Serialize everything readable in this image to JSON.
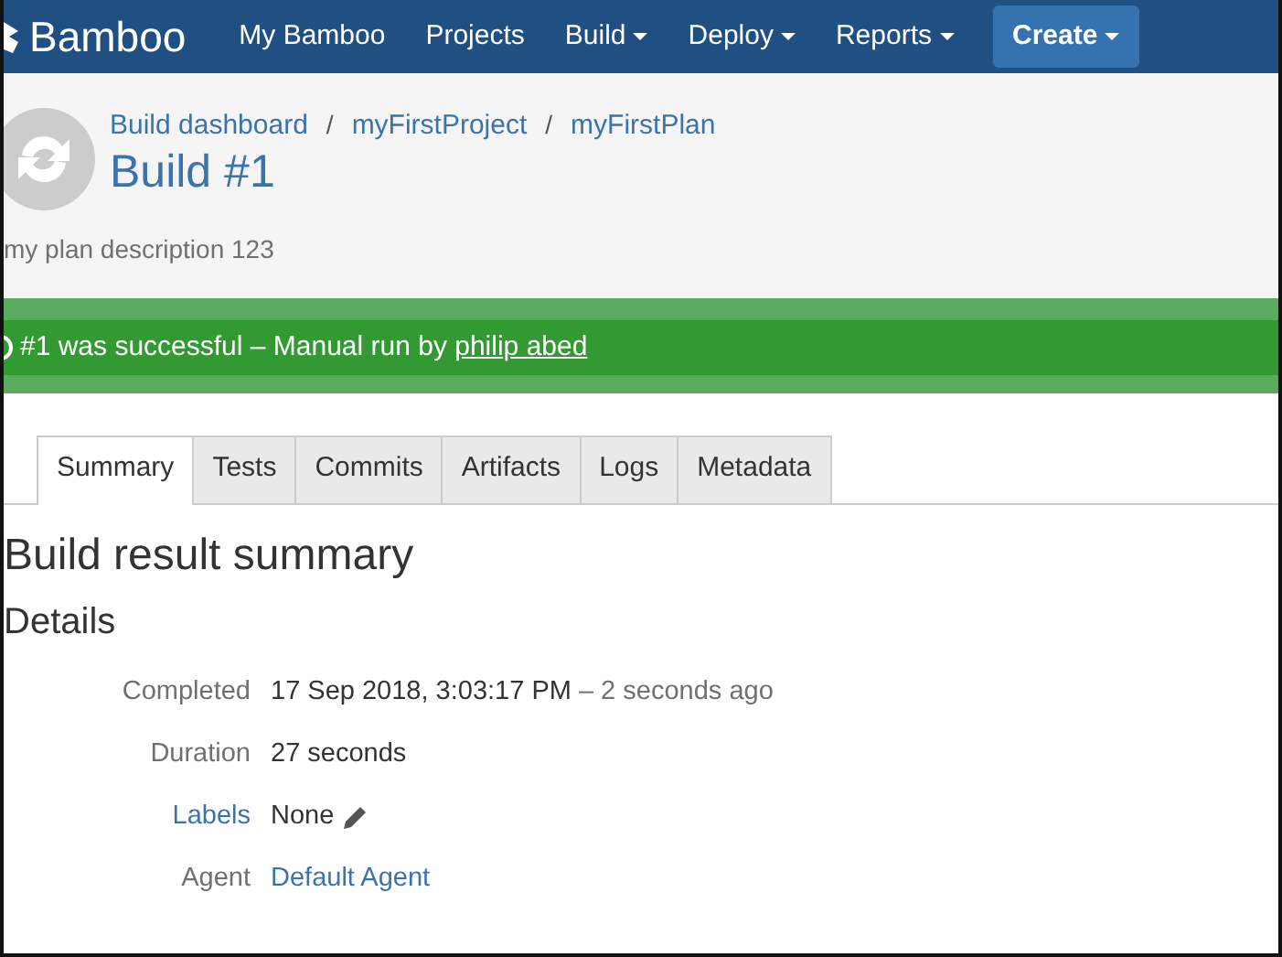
{
  "navbar": {
    "brand": "Bamboo",
    "items": [
      {
        "label": "My Bamboo",
        "dropdown": false
      },
      {
        "label": "Projects",
        "dropdown": false
      },
      {
        "label": "Build",
        "dropdown": true
      },
      {
        "label": "Deploy",
        "dropdown": true
      },
      {
        "label": "Reports",
        "dropdown": true
      }
    ],
    "create_button": "Create"
  },
  "header": {
    "breadcrumbs": [
      "Build dashboard",
      "myFirstProject",
      "myFirstPlan"
    ],
    "separators": [
      "/",
      "/"
    ],
    "title": "Build #1",
    "description": "my plan description 123"
  },
  "status_banner": {
    "text": "#1 was successful – Manual run by ",
    "user": "philip abed"
  },
  "tabs": [
    {
      "label": "Summary",
      "selected": true
    },
    {
      "label": "Tests",
      "selected": false
    },
    {
      "label": "Commits",
      "selected": false
    },
    {
      "label": "Artifacts",
      "selected": false
    },
    {
      "label": "Logs",
      "selected": false
    },
    {
      "label": "Metadata",
      "selected": false
    }
  ],
  "summary": {
    "heading": "Build result summary",
    "subheading": "Details",
    "details": [
      {
        "label": "Completed",
        "label_link": false,
        "value": "17 Sep 2018, 3:03:17 PM",
        "note": "– 2 seconds ago",
        "value_link": false,
        "editable": false
      },
      {
        "label": "Duration",
        "label_link": false,
        "value": "27 seconds",
        "value_link": false,
        "editable": false
      },
      {
        "label": "Labels",
        "label_link": true,
        "value": "None",
        "value_link": false,
        "editable": true
      },
      {
        "label": "Agent",
        "label_link": false,
        "value": "Default Agent",
        "value_link": true,
        "editable": false
      }
    ]
  }
}
